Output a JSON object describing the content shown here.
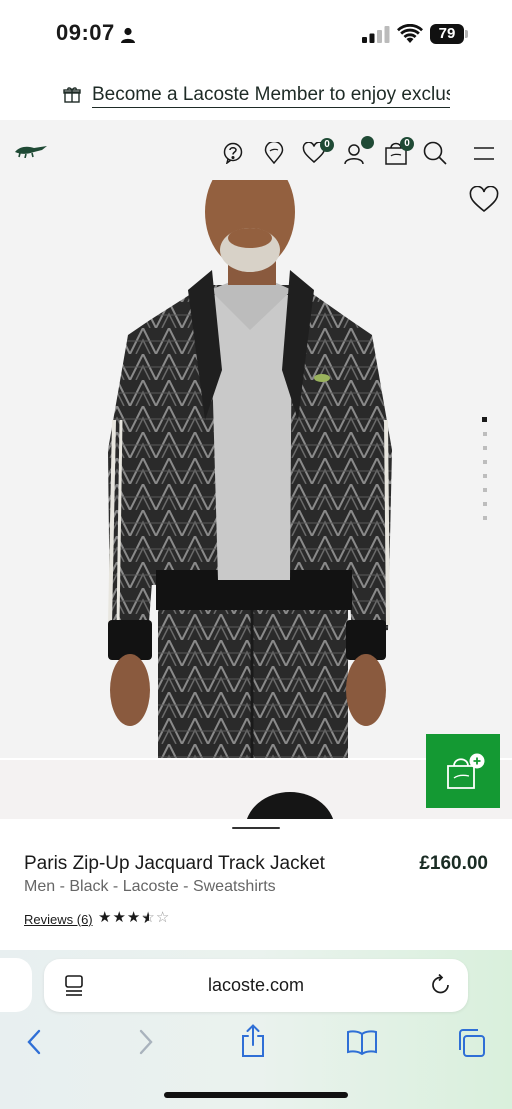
{
  "status_bar": {
    "time": "09:07",
    "battery": "79",
    "icons": [
      "person-icon",
      "signal-icon",
      "wifi-icon",
      "battery-icon"
    ]
  },
  "promo": {
    "text": "Become a Lacoste Member to enjoy exclusive",
    "icon": "gift-icon"
  },
  "header": {
    "logo": "lacoste-crocodile-logo",
    "wishlist_count": "0",
    "bag_count": "0",
    "icons": [
      "help-icon",
      "store-locator-icon",
      "wishlist-icon",
      "account-icon",
      "bag-icon",
      "search-icon",
      "menu-icon"
    ]
  },
  "product": {
    "title": "Paris Zip-Up Jacquard Track Jacket",
    "price": "£160.00",
    "meta": "Men - Black - Lacoste - Sweatshirts",
    "reviews_label": "Reviews (6)",
    "rating": 3.5,
    "rating_max": 5,
    "image_count": 8,
    "active_image": 1
  },
  "browser": {
    "url": "lacoste.com",
    "icons": [
      "back-icon",
      "forward-icon",
      "share-icon",
      "bookmarks-icon",
      "tabs-icon"
    ]
  },
  "colors": {
    "brand_green": "#1f4a35",
    "add_to_bag_green": "#149933",
    "text_dark": "#1a1a1a"
  }
}
